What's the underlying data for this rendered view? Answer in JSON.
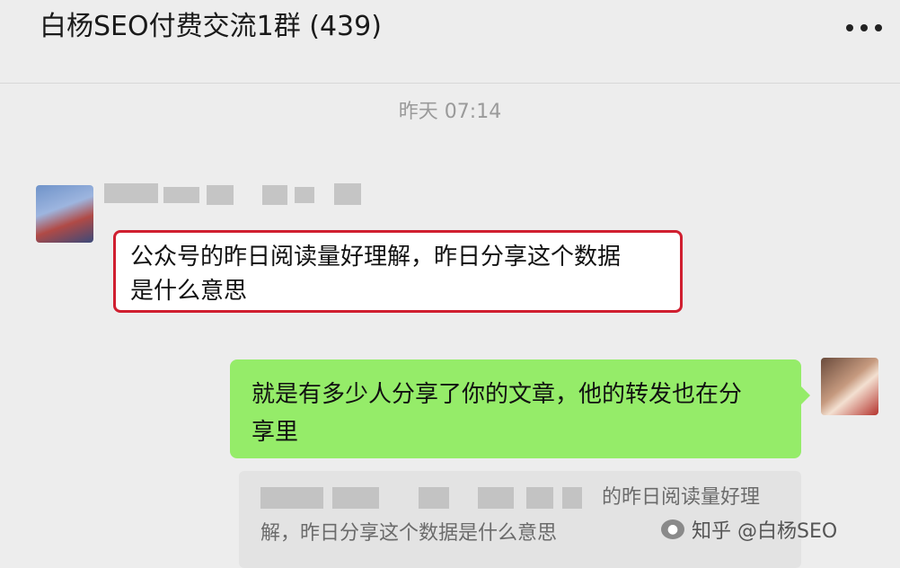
{
  "header": {
    "title": "白杨SEO付费交流1群 (439)",
    "more_icon": "more-dots-icon"
  },
  "chat": {
    "timestamp": "昨天 07:14",
    "incoming": {
      "sender_name_hidden": true,
      "text_line1": "公众号的昨日阅读量好理解，昨日分享这个数据",
      "text_line2": "是什么意思"
    },
    "outgoing": {
      "text_line1": "就是有多少人分享了你的文章，他的转发也在分",
      "text_line2": "享里"
    },
    "quote": {
      "line1": "的昨日阅读量好理",
      "line2": "解，昨日分享这个数据是什么意思"
    }
  },
  "watermark": {
    "text": "知乎 @白杨SEO",
    "icon": "wechat-logo-icon"
  },
  "colors": {
    "background": "#ededed",
    "outgoing_bubble": "#95ec69",
    "highlight_border": "#d01f30",
    "timestamp": "#9a9a9a"
  }
}
